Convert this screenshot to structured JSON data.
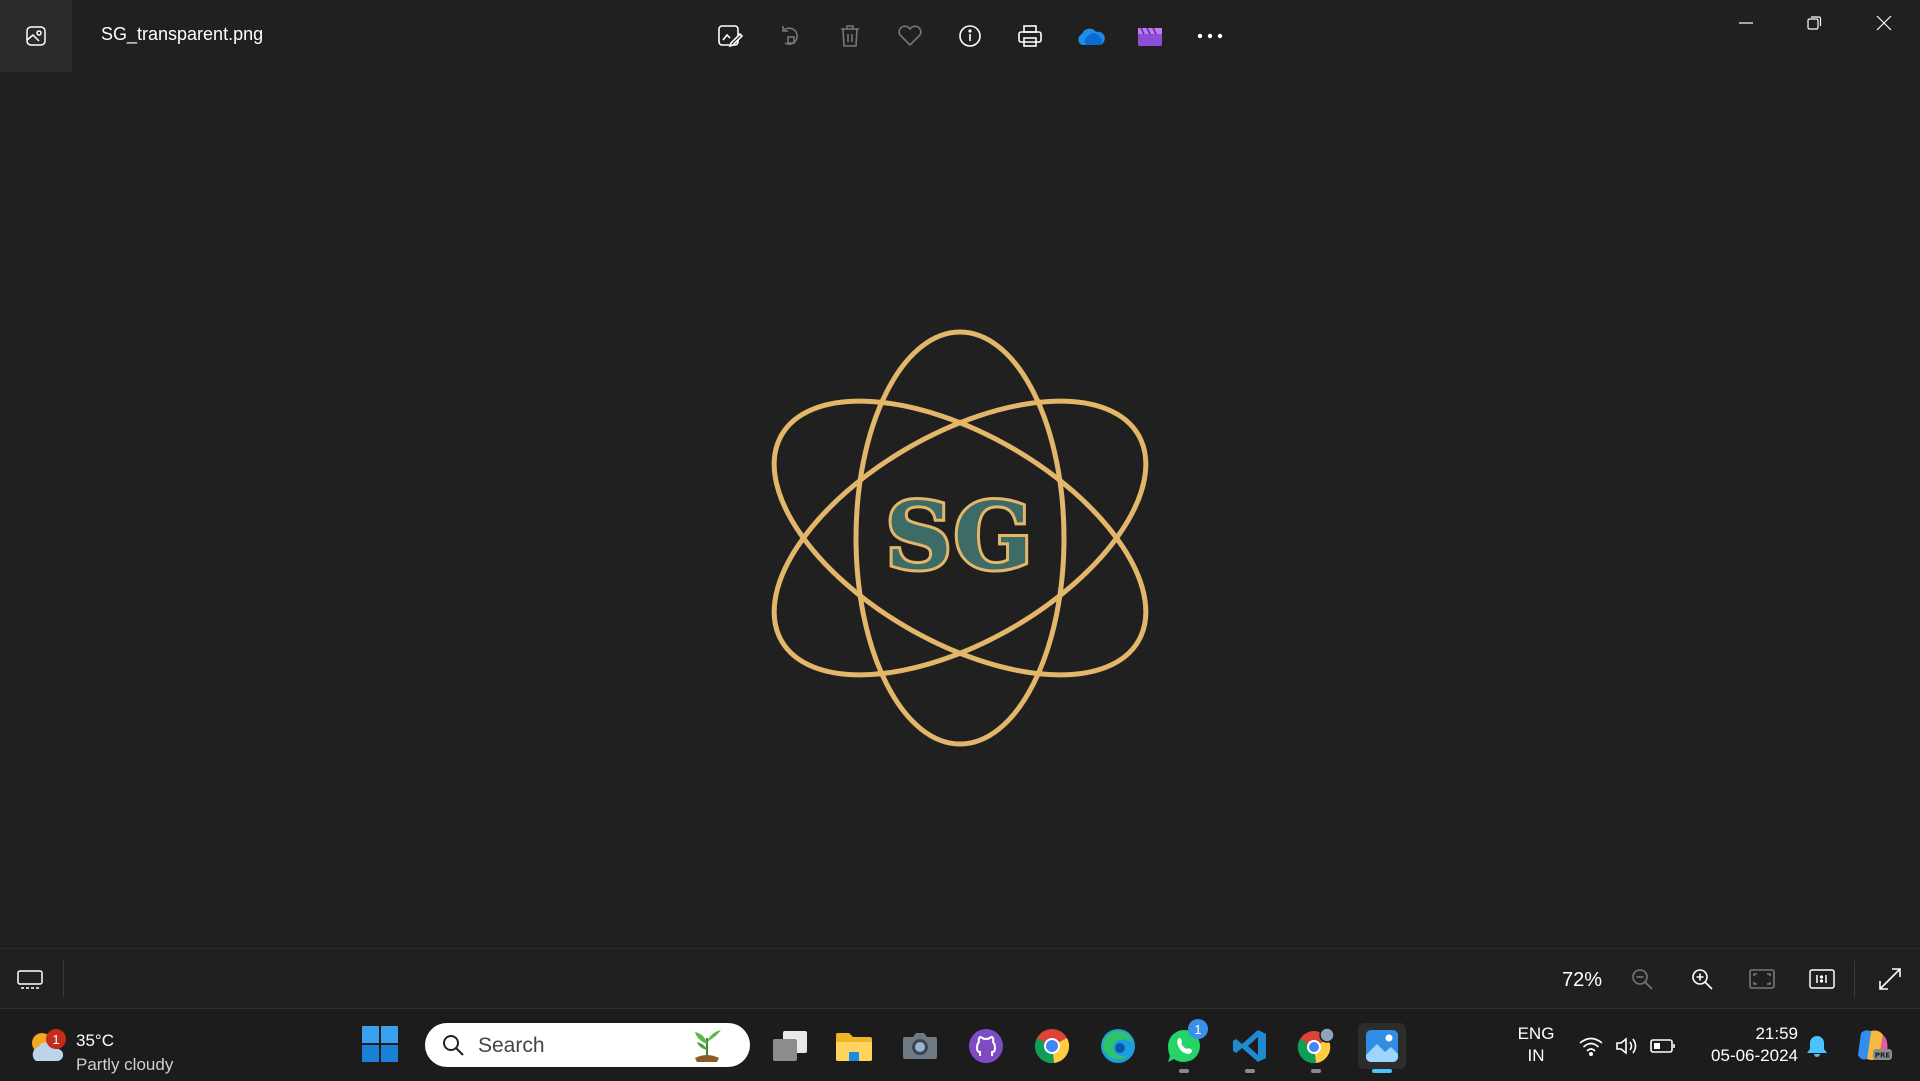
{
  "titlebar": {
    "file_name": "SG_transparent.png",
    "toolbar_icons": [
      "edit-image-icon",
      "rotate-icon",
      "delete-icon",
      "favorite-icon",
      "info-icon",
      "print-icon",
      "onedrive-icon",
      "clipchamp-icon",
      "more-icon"
    ],
    "window_controls": [
      "minimize-icon",
      "restore-icon",
      "close-icon"
    ]
  },
  "image": {
    "logo_text": "SG",
    "colors": {
      "orbit": "#e4b66a",
      "letters": "#3d6b66",
      "outline": "#e4b66a"
    }
  },
  "viewer_bar": {
    "zoom": "72%",
    "icons": [
      "filmstrip-icon",
      "zoom-out-icon",
      "zoom-in-icon",
      "fit-to-window-icon",
      "actual-size-icon",
      "fullscreen-icon"
    ]
  },
  "taskbar": {
    "weather": {
      "temp": "35°C",
      "desc": "Partly cloudy",
      "badge": "1"
    },
    "search": {
      "placeholder": "Search"
    },
    "apps": [
      {
        "name": "task-view"
      },
      {
        "name": "file-explorer"
      },
      {
        "name": "camera"
      },
      {
        "name": "github-desktop"
      },
      {
        "name": "chrome"
      },
      {
        "name": "edge"
      },
      {
        "name": "whatsapp",
        "badge": "1"
      },
      {
        "name": "vscode"
      },
      {
        "name": "chrome-profile"
      },
      {
        "name": "photos"
      }
    ],
    "lang": {
      "line1": "ENG",
      "line2": "IN"
    },
    "clock": {
      "time": "21:59",
      "date": "05-06-2024"
    },
    "accent": "#4cc2ff"
  }
}
